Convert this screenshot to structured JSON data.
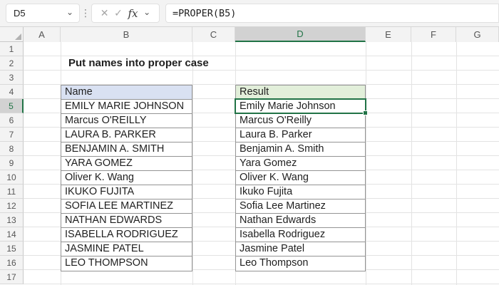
{
  "formula_bar": {
    "cell_reference": "D5",
    "formula": "=PROPER(B5)",
    "icons": {
      "cancel": "✕",
      "enter": "✓",
      "fx": "fx",
      "chevron": "⌄",
      "dots": "⋮"
    }
  },
  "sheet": {
    "title": "Put names into proper case",
    "column_headers": [
      "A",
      "B",
      "C",
      "D",
      "E",
      "F",
      "G"
    ],
    "row_headers": [
      "1",
      "2",
      "3",
      "4",
      "5",
      "6",
      "7",
      "8",
      "9",
      "10",
      "11",
      "12",
      "13",
      "14",
      "15",
      "16",
      "17"
    ],
    "active_cell": "D5",
    "active_column": "D",
    "active_row": "5",
    "name_table": {
      "header": "Name",
      "rows": [
        "EMILY MARIE JOHNSON",
        "Marcus O'REILLY",
        "LAURA B. PARKER",
        "BENJAMIN A. SMITH",
        "YARA GOMEZ",
        "Oliver K. Wang",
        "IKUKO FUJITA",
        "SOFIA LEE MARTINEZ",
        "NATHAN EDWARDS",
        "ISABELLA RODRIGUEZ",
        "JASMINE PATEL",
        "LEO THOMPSON"
      ]
    },
    "result_table": {
      "header": "Result",
      "rows": [
        "Emily Marie Johnson",
        "Marcus O'Reilly",
        "Laura B. Parker",
        "Benjamin A. Smith",
        "Yara Gomez",
        "Oliver K. Wang",
        "Ikuko Fujita",
        "Sofia Lee Martinez",
        "Nathan Edwards",
        "Isabella Rodriguez",
        "Jasmine Patel",
        "Leo Thompson"
      ]
    }
  },
  "colors": {
    "accent_green": "#217346",
    "name_header_fill": "#d9e1f2",
    "result_header_fill": "#e2efda",
    "table_border": "#949494"
  }
}
